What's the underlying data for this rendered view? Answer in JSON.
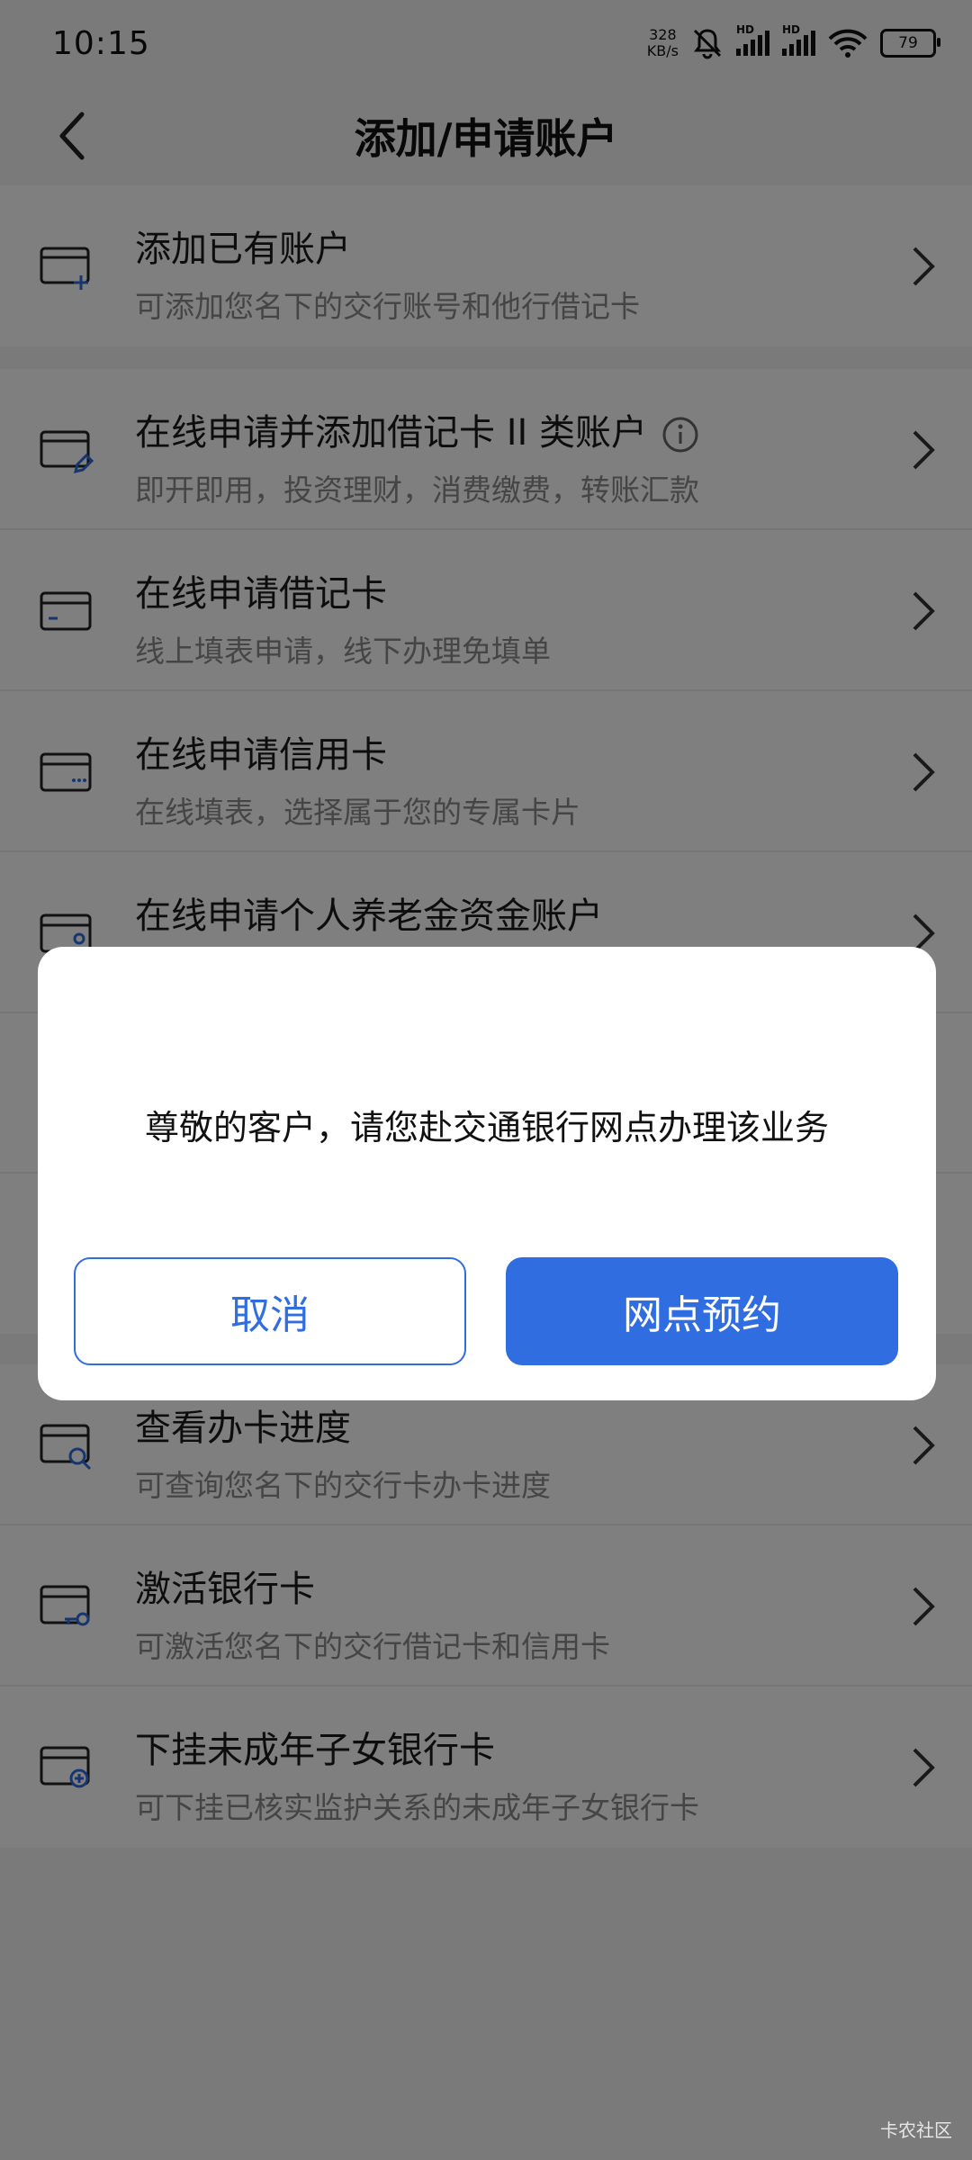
{
  "status_bar": {
    "time": "10:15",
    "net_speed": "328",
    "net_unit": "KB/s",
    "hd1": "HD",
    "hd2": "HD",
    "battery": "79"
  },
  "header": {
    "title": "添加/申请账户"
  },
  "list": [
    {
      "title": "添加已有账户",
      "subtitle": "可添加您名下的交行账号和他行借记卡",
      "icon": "card-add-icon"
    },
    {
      "title": "在线申请并添加借记卡 II 类账户",
      "subtitle": "即开即用，投资理财，消费缴费，转账汇款",
      "icon": "card-edit-icon"
    },
    {
      "title": "在线申请借记卡",
      "subtitle": "线上填表申请，线下办理免填单",
      "icon": "debit-card-icon"
    },
    {
      "title": "在线申请信用卡",
      "subtitle": "在线填表，选择属于您的专属卡片",
      "icon": "credit-card-icon"
    },
    {
      "title": "在线申请个人养老金资金账户",
      "subtitle": "",
      "icon": "pension-card-icon"
    },
    {
      "title": "查看办卡进度",
      "subtitle": "可查询您名下的交行卡办卡进度",
      "icon": "card-search-icon"
    },
    {
      "title": "激活银行卡",
      "subtitle": "可激活您名下的交行借记卡和信用卡",
      "icon": "card-key-icon"
    },
    {
      "title": "下挂未成年子女银行卡",
      "subtitle": "可下挂已核实监护关系的未成年子女银行卡",
      "icon": "card-plus-circle-icon"
    }
  ],
  "dialog": {
    "message": "尊敬的客户，请您赴交通银行网点办理该业务",
    "cancel_label": "取消",
    "confirm_label": "网点预约"
  },
  "watermark": "卡农社区",
  "colors": {
    "accent": "#2f6de1",
    "overlay": "rgba(0,0,0,0.5)"
  }
}
